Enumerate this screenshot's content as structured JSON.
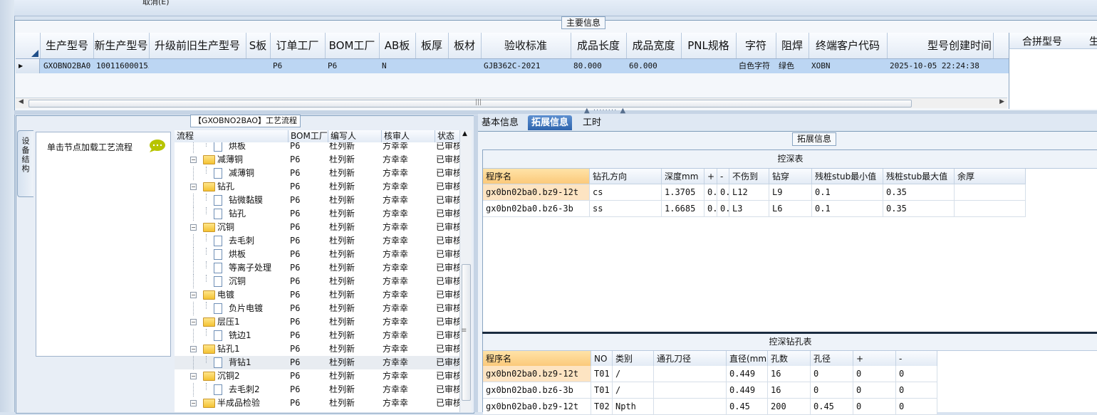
{
  "top": {
    "cut_label": "取消(E)"
  },
  "main_info": {
    "legend": "主要信息",
    "columns": [
      "生产型号",
      "新生产型号",
      "升级前旧生产型号",
      "S板",
      "订单工厂",
      "BOM工厂",
      "AB板",
      "板厚",
      "板材",
      "验收标准",
      "成品长度",
      "成品宽度",
      "PNL规格",
      "字符",
      "阻焊",
      "终端客户代码",
      "型号创建时间"
    ],
    "row": [
      "GXOBNO2BA0",
      "10011600015573",
      "",
      "",
      "P6",
      "P6",
      "N",
      "",
      "",
      "GJB362C-2021",
      "80.000",
      "60.000",
      "",
      "白色字符",
      "绿色",
      "XOBN",
      "2025-10-05 22:24:38"
    ],
    "right_columns": [
      "合拼型号",
      "生"
    ]
  },
  "process": {
    "legend": "【GXOBNO2BAO】工艺流程",
    "vtab": "设备结构",
    "node_hint": "单击节点加载工艺流程",
    "columns": [
      "流程",
      "BOM工厂",
      "编写人",
      "核审人",
      "状态"
    ],
    "rows": [
      {
        "level": 2,
        "type": "doc",
        "name": "烘板",
        "bom": "P6",
        "writer": "杜列新",
        "reviewer": "方幸幸",
        "status": "已审核"
      },
      {
        "level": 1,
        "type": "folder",
        "name": "减薄铜",
        "bom": "P6",
        "writer": "杜列新",
        "reviewer": "方幸幸",
        "status": "已审核"
      },
      {
        "level": 2,
        "type": "doc",
        "name": "减薄铜",
        "bom": "P6",
        "writer": "杜列新",
        "reviewer": "方幸幸",
        "status": "已审核"
      },
      {
        "level": 1,
        "type": "folder",
        "name": "钻孔",
        "bom": "P6",
        "writer": "杜列新",
        "reviewer": "方幸幸",
        "status": "已审核"
      },
      {
        "level": 2,
        "type": "doc",
        "name": "钻微黏膜",
        "bom": "P6",
        "writer": "杜列新",
        "reviewer": "方幸幸",
        "status": "已审核"
      },
      {
        "level": 2,
        "type": "doc",
        "name": "钻孔",
        "bom": "P6",
        "writer": "杜列新",
        "reviewer": "方幸幸",
        "status": "已审核"
      },
      {
        "level": 1,
        "type": "folder",
        "name": "沉铜",
        "bom": "P6",
        "writer": "杜列新",
        "reviewer": "方幸幸",
        "status": "已审核"
      },
      {
        "level": 2,
        "type": "doc",
        "name": "去毛刺",
        "bom": "P6",
        "writer": "杜列新",
        "reviewer": "方幸幸",
        "status": "已审核"
      },
      {
        "level": 2,
        "type": "doc",
        "name": "烘板",
        "bom": "P6",
        "writer": "杜列新",
        "reviewer": "方幸幸",
        "status": "已审核"
      },
      {
        "level": 2,
        "type": "doc",
        "name": "等离子处理",
        "bom": "P6",
        "writer": "杜列新",
        "reviewer": "方幸幸",
        "status": "已审核"
      },
      {
        "level": 2,
        "type": "doc",
        "name": "沉铜",
        "bom": "P6",
        "writer": "杜列新",
        "reviewer": "方幸幸",
        "status": "已审核"
      },
      {
        "level": 1,
        "type": "folder",
        "name": "电镀",
        "bom": "P6",
        "writer": "杜列新",
        "reviewer": "方幸幸",
        "status": "已审核"
      },
      {
        "level": 2,
        "type": "doc",
        "name": "负片电镀",
        "bom": "P6",
        "writer": "杜列新",
        "reviewer": "方幸幸",
        "status": "已审核"
      },
      {
        "level": 1,
        "type": "folder",
        "name": "层压1",
        "bom": "P6",
        "writer": "杜列新",
        "reviewer": "方幸幸",
        "status": "已审核"
      },
      {
        "level": 2,
        "type": "doc",
        "name": "铣边1",
        "bom": "P6",
        "writer": "杜列新",
        "reviewer": "方幸幸",
        "status": "已审核"
      },
      {
        "level": 1,
        "type": "folder",
        "name": "钻孔1",
        "bom": "P6",
        "writer": "杜列新",
        "reviewer": "方幸幸",
        "status": "已审核"
      },
      {
        "level": 2,
        "type": "doc",
        "name": "背钻1",
        "bom": "P6",
        "writer": "杜列新",
        "reviewer": "方幸幸",
        "status": "已审核",
        "selected": true
      },
      {
        "level": 1,
        "type": "folder",
        "name": "沉铜2",
        "bom": "P6",
        "writer": "杜列新",
        "reviewer": "方幸幸",
        "status": "已审核"
      },
      {
        "level": 2,
        "type": "doc",
        "name": "去毛刺2",
        "bom": "P6",
        "writer": "杜列新",
        "reviewer": "方幸幸",
        "status": "已审核"
      },
      {
        "level": 1,
        "type": "folder",
        "name": "半成品检验",
        "bom": "P6",
        "writer": "杜列新",
        "reviewer": "方幸幸",
        "status": "已审核"
      }
    ]
  },
  "tabs": [
    {
      "label": "基本信息",
      "active": false
    },
    {
      "label": "拓展信息",
      "active": true
    },
    {
      "label": "工时",
      "active": false
    }
  ],
  "ext": {
    "legend": "拓展信息",
    "table1": {
      "title": "控深表",
      "columns": [
        "程序名",
        "钻孔方向",
        "深度mm",
        "+",
        "-",
        "不伤到",
        "钻穿",
        "残桩stub最小值",
        "残桩stub最大值",
        "余厚"
      ],
      "rows": [
        [
          "gx0bn02ba0.bz9-12t",
          "cs",
          "1.3705",
          "0..",
          "0..",
          "L12",
          "L9",
          "0.1",
          "0.35",
          ""
        ],
        [
          "gx0bn02ba0.bz6-3b",
          "ss",
          "1.6685",
          "0..",
          "0..",
          "L3",
          "L6",
          "0.1",
          "0.35",
          ""
        ]
      ]
    },
    "table2": {
      "title": "控深钻孔表",
      "columns": [
        "程序名",
        "NO",
        "类别",
        "通孔刀径",
        "直径(mm)",
        "孔数",
        "孔径",
        "+",
        "-"
      ],
      "rows": [
        [
          "gx0bn02ba0.bz9-12t",
          "T01",
          "/",
          "",
          "0.449",
          "16",
          "0",
          "0",
          "0"
        ],
        [
          "gx0bn02ba0.bz6-3b",
          "T01",
          "/",
          "",
          "0.449",
          "16",
          "0",
          "0",
          "0"
        ],
        [
          "gx0bn02ba0.bz9-12t",
          "T02",
          "Npth",
          "",
          "0.45",
          "200",
          "0.45",
          "0",
          "0"
        ]
      ]
    }
  },
  "colors": {
    "selection": "#bcd6f3",
    "active_tab": "#2e64ad",
    "highlight": "#fbc97a"
  }
}
